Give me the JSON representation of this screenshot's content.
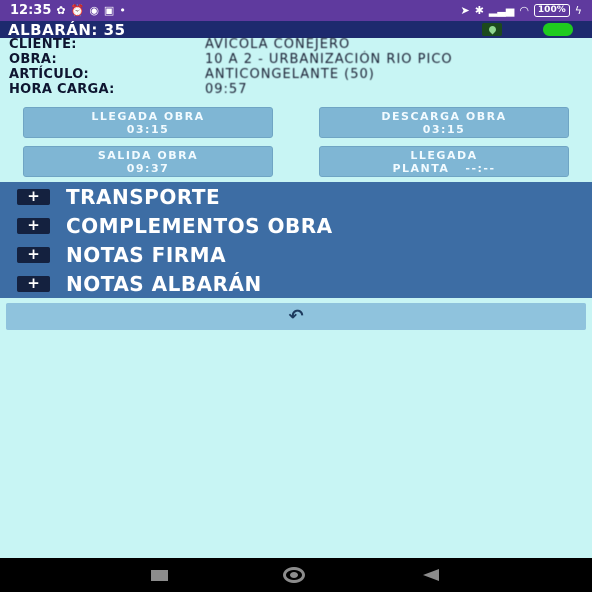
{
  "status_bar": {
    "time": "12:35",
    "left_icons": [
      "settings-icon",
      "alarm-icon",
      "app-icon",
      "gallery-icon"
    ],
    "battery": "100%"
  },
  "title_bar": {
    "title": "ALBARÁN: 35",
    "status_color": "#1fcb1f"
  },
  "info": {
    "rows": [
      {
        "label": "CLIENTE:",
        "value": "AVICOLA CONEJERO"
      },
      {
        "label": "OBRA:",
        "value": "10 A 2 - URBANIZACIÓN RIO PICO"
      },
      {
        "label": "ARTÍCULO:",
        "value": "ANTICONGELANTE (50)"
      },
      {
        "label": "HORA CARGA:",
        "value": "09:57"
      }
    ]
  },
  "time_buttons": {
    "llegada_obra": {
      "label": "LLEGADA OBRA",
      "value": "03:15"
    },
    "descarga_obra": {
      "label": "DESCARGA OBRA",
      "value": "03:15"
    },
    "salida_obra": {
      "label": "SALIDA OBRA",
      "value": "09:37"
    },
    "llegada_planta": {
      "label": "LLEGADA",
      "value": "PLANTA   --:--"
    }
  },
  "sections": [
    {
      "symbol": "+",
      "label": "TRANSPORTE"
    },
    {
      "symbol": "+",
      "label": "COMPLEMENTOS OBRA"
    },
    {
      "symbol": "+",
      "label": "NOTAS FIRMA"
    },
    {
      "symbol": "+",
      "label": "NOTAS ALBARÁN"
    }
  ],
  "back_button": {
    "icon": "undo-icon",
    "glyph": "↶"
  },
  "colors": {
    "background": "#c8f5f4",
    "status_bar": "#5f3a9e",
    "title_bar": "#1d2a6e",
    "panel": "#3d6da4",
    "button": "#7fb6d4"
  }
}
